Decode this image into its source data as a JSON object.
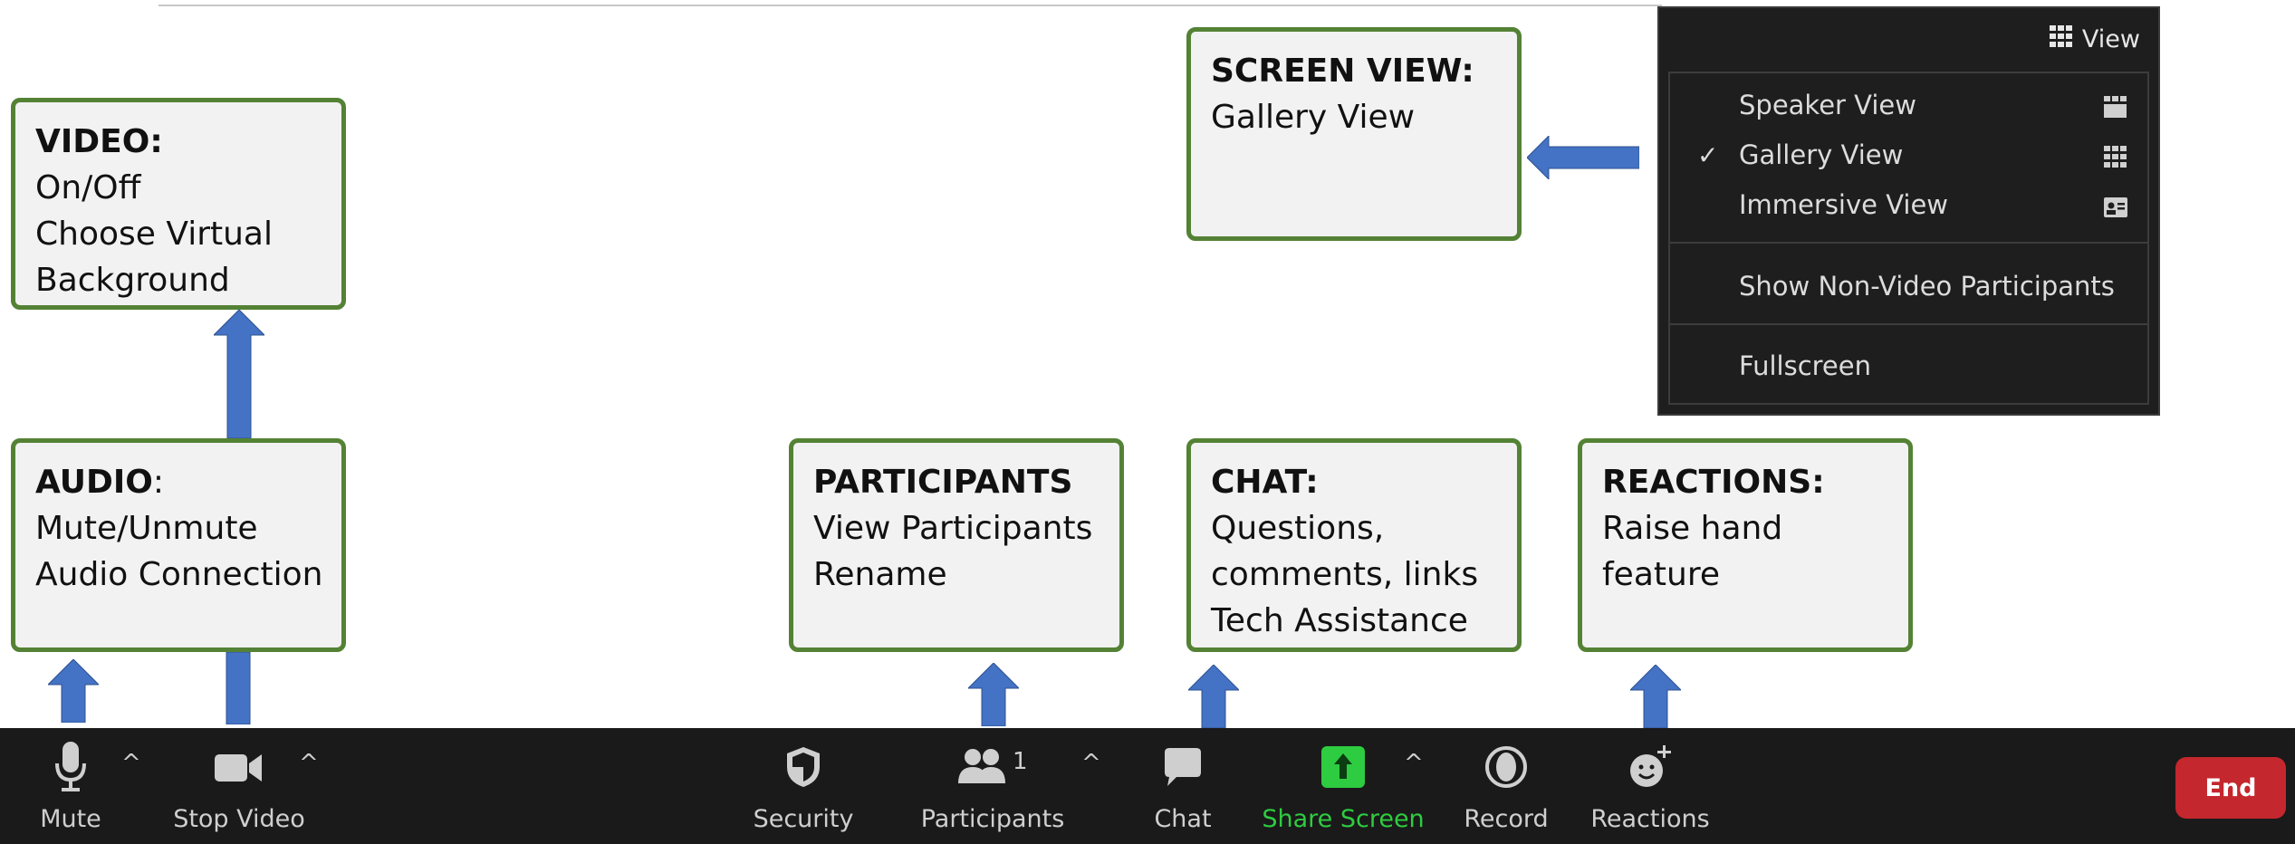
{
  "boxes": {
    "video": {
      "title": "VIDEO:",
      "lines": [
        "On/Off",
        "Choose Virtual",
        "Background"
      ]
    },
    "audio": {
      "title": "AUDIO",
      "title_suffix": ":",
      "lines": [
        "Mute/Unmute",
        "Audio Connection"
      ]
    },
    "participants": {
      "title": "PARTICIPANTS",
      "lines": [
        "View Participants",
        "Rename"
      ]
    },
    "chat": {
      "title": "CHAT:",
      "lines": [
        "Questions,",
        "comments, links",
        "Tech Assistance"
      ]
    },
    "reactions": {
      "title": "REACTIONS:",
      "lines": [
        "Raise hand",
        "feature"
      ]
    },
    "screen_view": {
      "title": "SCREEN VIEW:",
      "lines": [
        "Gallery View"
      ]
    }
  },
  "view_menu": {
    "button_label": "View",
    "button_icon": "grid-icon",
    "items": [
      {
        "label": "Speaker View",
        "checked": false,
        "icon": "speaker-view-icon"
      },
      {
        "label": "Gallery View",
        "checked": true,
        "icon": "gallery-view-icon"
      },
      {
        "label": "Immersive View",
        "checked": false,
        "icon": "immersive-view-icon"
      },
      {
        "label": "Show Non-Video Participants",
        "checked": false
      },
      {
        "label": "Fullscreen",
        "checked": false
      }
    ],
    "check_glyph": "✓"
  },
  "toolbar": {
    "mute_label": "Mute",
    "stop_video_label": "Stop Video",
    "security_label": "Security",
    "participants_label": "Participants",
    "participants_count": "1",
    "chat_label": "Chat",
    "share_screen_label": "Share Screen",
    "record_label": "Record",
    "reactions_label": "Reactions",
    "end_label": "End",
    "caret_glyph": "^"
  },
  "colors": {
    "box_border": "#548235",
    "box_fill": "#f2f2f2",
    "arrow": "#4472c4",
    "toolbar_bg": "#1a1a1a",
    "share_green": "#2ecc40",
    "end_red": "#c4272d"
  }
}
